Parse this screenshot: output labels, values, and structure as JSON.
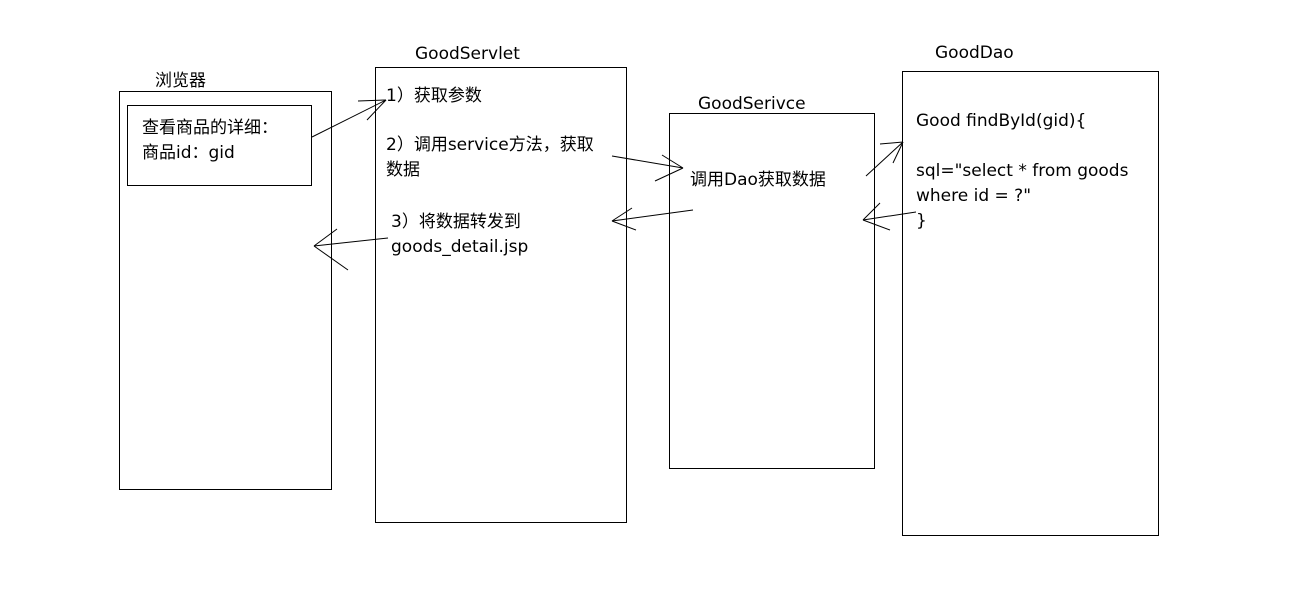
{
  "browser": {
    "title": "浏览器",
    "note_lines": [
      "查看商品的详细：",
      "商品id：gid"
    ]
  },
  "servlet": {
    "title": "GoodServlet",
    "step1": "1）获取参数",
    "step2_lines": [
      "2）调用service方法，获取",
      "数据"
    ],
    "step3_lines": [
      "3）将数据转发到",
      "goods_detail.jsp"
    ]
  },
  "service": {
    "title": "GoodSerivce",
    "text": "调用Dao获取数据"
  },
  "dao": {
    "title": "GoodDao",
    "code_lines": [
      "Good  findById(gid){",
      "",
      "sql=\"select * from goods",
      "where id = ?\"",
      "}"
    ]
  },
  "colors": {
    "stroke": "#000000",
    "background": "#ffffff"
  }
}
